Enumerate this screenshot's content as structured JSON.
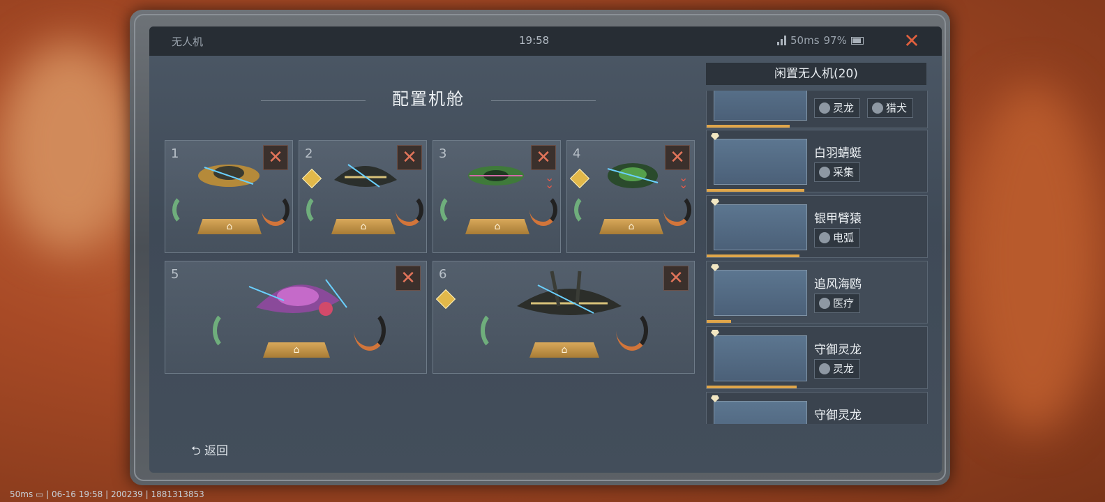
{
  "topbar": {
    "title": "无人机",
    "time": "19:58",
    "ping": "50ms",
    "battery": "97%",
    "close": "✕"
  },
  "heading": "配置机舱",
  "slots": [
    {
      "num": "1",
      "remove": "✕"
    },
    {
      "num": "2",
      "remove": "✕"
    },
    {
      "num": "3",
      "remove": "✕"
    },
    {
      "num": "4",
      "remove": "✕"
    },
    {
      "num": "5",
      "remove": "✕"
    },
    {
      "num": "6",
      "remove": "✕"
    }
  ],
  "pad_icon": "⌂",
  "side": {
    "header": "闲置无人机(20)",
    "cards": [
      {
        "name": "",
        "tags": [
          "灵龙",
          "猎犬"
        ],
        "level": 0.85
      },
      {
        "name": "白羽蜻蜓",
        "tags": [
          "采集"
        ],
        "level": 1.0
      },
      {
        "name": "银甲臂猿",
        "tags": [
          "电弧"
        ],
        "level": 0.95
      },
      {
        "name": "追风海鸥",
        "tags": [
          "医疗"
        ],
        "level": 0.25
      },
      {
        "name": "守御灵龙",
        "tags": [
          "灵龙"
        ],
        "level": 0.92
      },
      {
        "name": "守御灵龙",
        "tags": [],
        "level": 0
      }
    ]
  },
  "back": "⮌ 返回",
  "bottombar": "50ms ▭ | 06-16 19:58 | 200239 | 1881313853",
  "colors": {
    "accent": "#e0603e",
    "gold": "#e0a64a",
    "green": "#6fae7c"
  }
}
